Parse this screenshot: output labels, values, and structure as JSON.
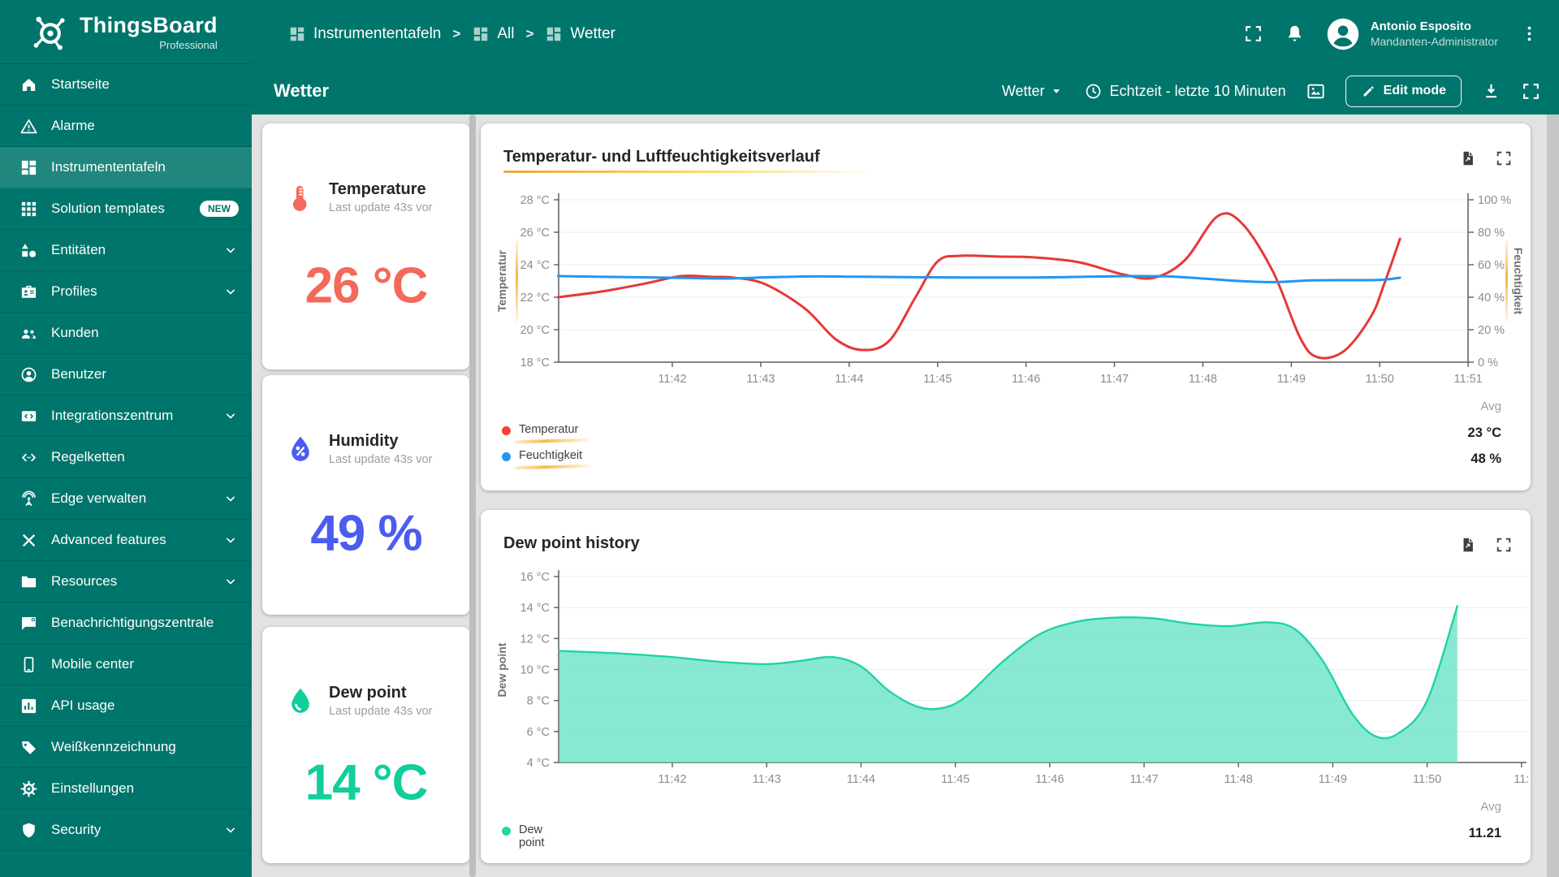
{
  "app": {
    "name": "ThingsBoard",
    "edition": "Professional",
    "logo_icon": "logo-icon"
  },
  "header": {
    "breadcrumb": [
      {
        "label": "Instrumententafeln",
        "icon": "dashboard-icon"
      },
      {
        "label": "All",
        "icon": "dashboard-icon"
      },
      {
        "label": "Wetter",
        "icon": "dashboard-icon"
      }
    ],
    "separator": ">",
    "action_icons": [
      "fullscreen-icon",
      "bell-icon"
    ],
    "user": {
      "name": "Antonio Esposito",
      "role": "Mandanten-Administrator",
      "avatar_icon": "avatar-icon"
    },
    "menu_icon": "dots-vertical-icon"
  },
  "toolbar": {
    "page_title": "Wetter",
    "state_label": "Wetter",
    "state_caret_icon": "caret-down-icon",
    "time_icon": "clock-icon",
    "time_label": "Echtzeit - letzte 10 Minuten",
    "edit_label": "Edit mode",
    "action_icons": [
      "image-icon",
      "pencil-icon",
      "download-icon",
      "fullscreen-icon"
    ]
  },
  "sidebar": {
    "items": [
      {
        "label": "Startseite",
        "icon": "home-icon",
        "selected": false,
        "expandable": false
      },
      {
        "label": "Alarme",
        "icon": "warning-icon",
        "selected": false,
        "expandable": false
      },
      {
        "label": "Instrumententafeln",
        "icon": "dashboard-icon",
        "selected": true,
        "expandable": false
      },
      {
        "label": "Solution templates",
        "icon": "grid-icon",
        "selected": false,
        "expandable": false,
        "badge": "NEW"
      },
      {
        "label": "Entitäten",
        "icon": "shapes-icon",
        "selected": false,
        "expandable": true
      },
      {
        "label": "Profiles",
        "icon": "badge-icon",
        "selected": false,
        "expandable": true
      },
      {
        "label": "Kunden",
        "icon": "people-icon",
        "selected": false,
        "expandable": false
      },
      {
        "label": "Benutzer",
        "icon": "person-icon",
        "selected": false,
        "expandable": false
      },
      {
        "label": "Integrationszentrum",
        "icon": "integration-icon",
        "selected": false,
        "expandable": true
      },
      {
        "label": "Regelketten",
        "icon": "code-icon",
        "selected": false,
        "expandable": false
      },
      {
        "label": "Edge verwalten",
        "icon": "antenna-icon",
        "selected": false,
        "expandable": true
      },
      {
        "label": "Advanced features",
        "icon": "tools-icon",
        "selected": false,
        "expandable": true
      },
      {
        "label": "Resources",
        "icon": "folder-icon",
        "selected": false,
        "expandable": true
      },
      {
        "label": "Benachrichtigungszentrale",
        "icon": "notification-center-icon",
        "selected": false,
        "expandable": false
      },
      {
        "label": "Mobile center",
        "icon": "phone-icon",
        "selected": false,
        "expandable": false
      },
      {
        "label": "API usage",
        "icon": "chartbox-icon",
        "selected": false,
        "expandable": false
      },
      {
        "label": "Weißkennzeichnung",
        "icon": "tag-icon",
        "selected": false,
        "expandable": false
      },
      {
        "label": "Einstellungen",
        "icon": "gear-icon",
        "selected": false,
        "expandable": false
      },
      {
        "label": "Security",
        "icon": "shield-icon",
        "selected": false,
        "expandable": true
      }
    ]
  },
  "cards": [
    {
      "title": "Temperature",
      "subtitle": "Last update 43s vor",
      "value": "26",
      "unit": "°C",
      "color": "#f4695b",
      "icon": "thermometer-icon"
    },
    {
      "title": "Humidity",
      "subtitle": "Last update 43s vor",
      "value": "49",
      "unit": "%",
      "color": "#4b5cf0",
      "icon": "humidity-drop-icon"
    },
    {
      "title": "Dew point",
      "subtitle": "Last update 43s vor",
      "value": "14",
      "unit": "°C",
      "color": "#12ce9c",
      "icon": "dew-drop-icon"
    }
  ],
  "chart_data": [
    {
      "type": "line",
      "title": "Temperatur- und Luftfeuchtigkeitsverlauf",
      "action_icons": [
        "export-file-icon",
        "expand-icon"
      ],
      "x_tick_labels": [
        "11:42",
        "11:43",
        "11:44",
        "11:45",
        "11:46",
        "11:47",
        "11:48",
        "11:49",
        "11:50",
        "11:51"
      ],
      "left_axis": {
        "label": "Temperatur",
        "range": [
          18,
          28
        ],
        "tick_labels": [
          "28 °C",
          "26 °C",
          "24 °C",
          "22 °C",
          "20 °C",
          "18 °C"
        ]
      },
      "right_axis": {
        "label": "Feuchtigkeit",
        "range": [
          0,
          100
        ],
        "tick_labels": [
          "100 %",
          "80 %",
          "60 %",
          "40 %",
          "20 %",
          "0 %"
        ]
      },
      "series": [
        {
          "name": "Temperatur",
          "axis": "left",
          "color": "#e53935",
          "points": [
            [
              40.71,
              22.0
            ],
            [
              41.2,
              22.35
            ],
            [
              41.7,
              22.85
            ],
            [
              42.1,
              23.3
            ],
            [
              42.45,
              23.25
            ],
            [
              42.7,
              23.2
            ],
            [
              43.05,
              22.8
            ],
            [
              43.5,
              21.3
            ],
            [
              43.85,
              19.4
            ],
            [
              44.15,
              18.75
            ],
            [
              44.45,
              19.3
            ],
            [
              44.75,
              22.0
            ],
            [
              45.0,
              24.2
            ],
            [
              45.25,
              24.55
            ],
            [
              45.7,
              24.5
            ],
            [
              46.1,
              24.45
            ],
            [
              46.6,
              24.15
            ],
            [
              47.1,
              23.4
            ],
            [
              47.45,
              23.2
            ],
            [
              47.8,
              24.3
            ],
            [
              48.17,
              27.0
            ],
            [
              48.45,
              26.5
            ],
            [
              48.8,
              23.5
            ],
            [
              49.1,
              19.5
            ],
            [
              49.3,
              18.3
            ],
            [
              49.6,
              18.7
            ],
            [
              49.9,
              20.8
            ],
            [
              50.05,
              22.8
            ],
            [
              50.23,
              25.6
            ]
          ]
        },
        {
          "name": "Feuchtigkeit",
          "axis": "right",
          "color": "#2196f3",
          "points": [
            [
              40.71,
              53
            ],
            [
              41.3,
              52.5
            ],
            [
              42.0,
              52
            ],
            [
              42.6,
              51.5
            ],
            [
              43.1,
              52.3
            ],
            [
              43.6,
              52.8
            ],
            [
              44.1,
              52.6
            ],
            [
              44.6,
              52.4
            ],
            [
              45.1,
              52.2
            ],
            [
              45.7,
              52.1
            ],
            [
              46.2,
              52.2
            ],
            [
              46.7,
              52.6
            ],
            [
              47.2,
              53
            ],
            [
              47.6,
              52.8
            ],
            [
              48.0,
              51.5
            ],
            [
              48.4,
              50.0
            ],
            [
              48.8,
              49.3
            ],
            [
              49.2,
              50.3
            ],
            [
              49.6,
              50.5
            ],
            [
              50.0,
              50.6
            ],
            [
              50.23,
              52.0
            ]
          ]
        }
      ],
      "legend": [
        {
          "label": "Temperatur",
          "color": "#f44336"
        },
        {
          "label": "Feuchtigkeit",
          "color": "#2196f3"
        }
      ],
      "summary": {
        "header": "Avg",
        "values": [
          "23 °C",
          "48 %"
        ]
      }
    },
    {
      "type": "area",
      "title": "Dew point history",
      "action_icons": [
        "export-file-icon",
        "expand-icon"
      ],
      "x_tick_labels": [
        "11:42",
        "11:43",
        "11:44",
        "11:45",
        "11:46",
        "11:47",
        "11:48",
        "11:49",
        "11:50",
        "11:"
      ],
      "left_axis": {
        "label": "Dew point",
        "range": [
          4,
          16
        ],
        "tick_labels": [
          "16 °C",
          "14 °C",
          "12 °C",
          "10 °C",
          "8 °C",
          "6 °C",
          "4 °C"
        ]
      },
      "series": [
        {
          "name": "Dew point",
          "axis": "left",
          "color": "#1fd3a6",
          "fill": "rgba(105,228,198,0.8)",
          "points": [
            [
              40.8,
              11.2
            ],
            [
              41.4,
              11.05
            ],
            [
              42.0,
              10.8
            ],
            [
              42.5,
              10.5
            ],
            [
              43.0,
              10.35
            ],
            [
              43.35,
              10.55
            ],
            [
              43.7,
              10.8
            ],
            [
              44.0,
              10.2
            ],
            [
              44.3,
              8.6
            ],
            [
              44.6,
              7.6
            ],
            [
              44.85,
              7.5
            ],
            [
              45.1,
              8.2
            ],
            [
              45.5,
              10.5
            ],
            [
              45.9,
              12.3
            ],
            [
              46.3,
              13.1
            ],
            [
              46.7,
              13.35
            ],
            [
              47.1,
              13.3
            ],
            [
              47.5,
              12.95
            ],
            [
              47.9,
              12.8
            ],
            [
              48.3,
              13.05
            ],
            [
              48.6,
              12.6
            ],
            [
              48.9,
              10.5
            ],
            [
              49.2,
              7.2
            ],
            [
              49.45,
              5.7
            ],
            [
              49.7,
              5.9
            ],
            [
              50.0,
              8.0
            ],
            [
              50.32,
              14.1
            ]
          ]
        }
      ],
      "legend": [
        {
          "label": "Dew point",
          "color": "#2bd4a8"
        }
      ],
      "summary": {
        "header": "Avg",
        "values": [
          "11.21"
        ]
      }
    }
  ],
  "accent_colors": {
    "yellow": "#f5b63d",
    "teal": "#00756b"
  }
}
